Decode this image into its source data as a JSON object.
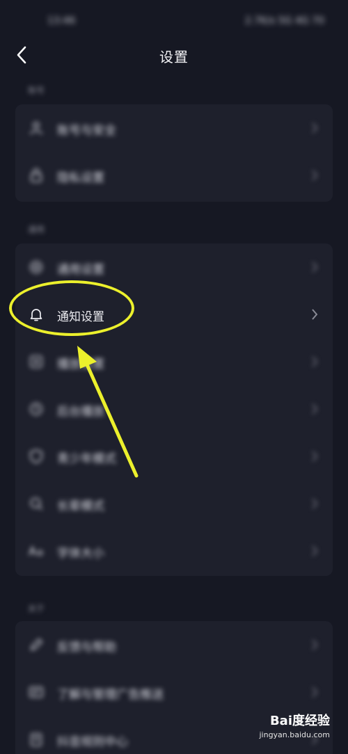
{
  "status_bar": {
    "time": "13:46",
    "icons": "2.7K/s 5G 4G 70"
  },
  "header": {
    "title": "设置"
  },
  "sections": [
    {
      "title": "账号",
      "items": [
        {
          "label": "账号与安全",
          "icon": "user-icon"
        },
        {
          "label": "隐私设置",
          "icon": "lock-icon"
        }
      ]
    },
    {
      "title": "通用",
      "items": [
        {
          "label": "通用设置",
          "icon": "gear-icon"
        },
        {
          "label": "通知设置",
          "icon": "bell-icon"
        },
        {
          "label": "播放设置",
          "icon": "play-icon"
        },
        {
          "label": "后台播放",
          "icon": "clock-icon"
        },
        {
          "label": "青少年模式",
          "icon": "shield-icon"
        },
        {
          "label": "长辈模式",
          "icon": "search-icon"
        },
        {
          "label": "字体大小",
          "icon": "font-size-icon"
        }
      ]
    },
    {
      "title": "关于",
      "items": [
        {
          "label": "反馈与帮助",
          "icon": "edit-icon"
        },
        {
          "label": "了解与管理广告推送",
          "icon": "ad-icon"
        },
        {
          "label": "抖音规则中心",
          "icon": "rules-icon"
        }
      ]
    }
  ],
  "annotation": {
    "highlight_color": "#ecf02c"
  },
  "watermark": {
    "logo": "Bai度经验",
    "url": "jingyan.baidu.com"
  }
}
